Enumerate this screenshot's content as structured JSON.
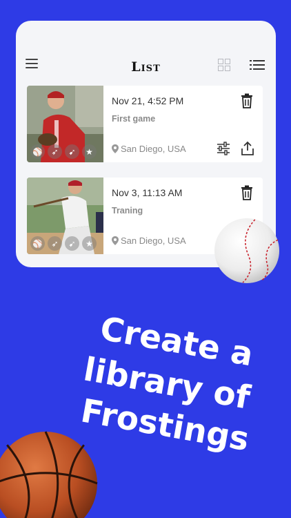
{
  "header": {
    "title": "List"
  },
  "items": [
    {
      "date": "Nov 21, 4:52 PM",
      "label": "First game",
      "location": "San Diego, USA"
    },
    {
      "date": "Nov 3, 11:13 AM",
      "label": "Traning",
      "location": "San Diego, USA"
    }
  ],
  "tagline": {
    "line1": "Create a",
    "line2": "library of",
    "line3": "Frostings"
  },
  "colors": {
    "background": "#2e3be6",
    "card": "#f4f5f8",
    "tagline_text": "#ffffff"
  },
  "icons": [
    "menu-icon",
    "grid-view-icon",
    "list-view-icon",
    "trash-icon",
    "sliders-icon",
    "share-icon",
    "location-pin-icon",
    "star-icon",
    "baseball-image",
    "basketball-image"
  ]
}
